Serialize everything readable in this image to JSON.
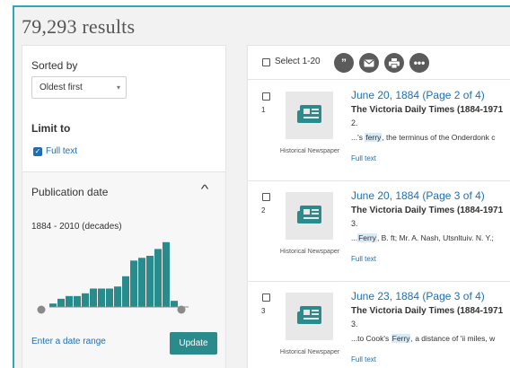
{
  "results_title": "79,293 results",
  "sort": {
    "label": "Sorted by",
    "value": "Oldest first"
  },
  "limit": {
    "label": "Limit to",
    "full_text_label": "Full text",
    "full_text_checked": true
  },
  "publication_date": {
    "label": "Publication date",
    "range_label": "1884 - 2010 (decades)",
    "histogram_values": [
      0.05,
      0.12,
      0.16,
      0.16,
      0.2,
      0.27,
      0.27,
      0.27,
      0.3,
      0.45,
      0.68,
      0.72,
      0.75,
      0.85,
      0.95,
      0.09
    ],
    "bar_color": "#2a8b8d",
    "date_range_link": "Enter a date range",
    "update_label": "Update"
  },
  "toolbar": {
    "select_label": "Select 1-20",
    "icons": [
      "quote-icon",
      "email-icon",
      "print-icon",
      "more-icon"
    ]
  },
  "results": [
    {
      "num": "1",
      "title": "June 20, 1884 (Page 2 of 4)",
      "source": "The Victoria Daily Times (1884-1971",
      "issue": "2.",
      "snippet_before": "...'s ",
      "snippet_hl": "ferry",
      "snippet_after": ", the terminus of the Onderdonk c",
      "type": "Historical Newspaper",
      "fulltext": "Full text"
    },
    {
      "num": "2",
      "title": "June 20, 1884 (Page 3 of 4)",
      "source": "The Victoria Daily Times (1884-1971",
      "issue": "3.",
      "snippet_before": "...",
      "snippet_hl": "Ferry",
      "snippet_after": ", B. ft; Mr. A. Nash, Utsnltuiv. N. Y.;",
      "type": "Historical Newspaper",
      "fulltext": "Full text"
    },
    {
      "num": "3",
      "title": "June 23, 1884 (Page 3 of 4)",
      "source": "The Victoria Daily Times (1884-1971",
      "issue": "3.",
      "snippet_before": "...to Cook's ",
      "snippet_hl": "Ferry",
      "snippet_after": ", a distance of 'ii miles, w",
      "type": "Historical Newspaper",
      "fulltext": "Full text"
    }
  ]
}
